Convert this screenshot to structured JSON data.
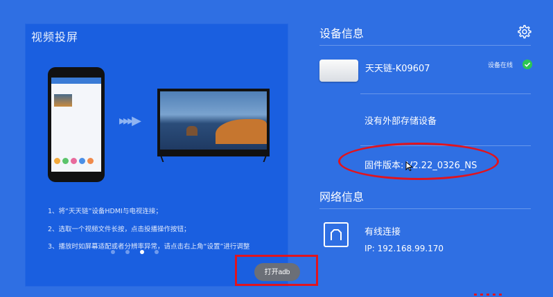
{
  "left": {
    "title": "视频投屏",
    "instructions": [
      "1、将“天天链”设备HDMI与电视连接；",
      "2、选取一个视频文件长按，点击投播操作按钮；",
      "3、播放时如屏幕适配或者分辨率异常，请点击右上角“设置”进行调整"
    ],
    "pager": {
      "count": 4,
      "active": 2
    },
    "adb_button": "打开adb"
  },
  "device_info": {
    "title": "设备信息",
    "device_name": "天天链-K09607",
    "status": "设备在线",
    "storage": "没有外部存储设备",
    "firmware": "固件版本: V2.22_0326_NS"
  },
  "network_info": {
    "title": "网络信息",
    "type": "有线连接",
    "ip": "IP: 192.168.99.170"
  },
  "colors": {
    "background": "#2f6fe3",
    "panel": "#1a5fe0",
    "annotation_red": "#e0141e",
    "online_green": "#2dc653"
  },
  "icons": [
    "gear-icon",
    "check-icon",
    "network-icon",
    "cursor-icon"
  ]
}
